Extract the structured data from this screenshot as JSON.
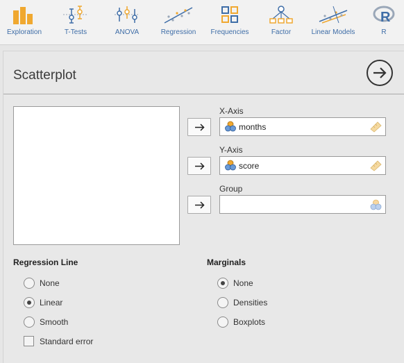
{
  "toolbar": {
    "items": [
      {
        "label": "Exploration",
        "icon": "bar-chart-icon"
      },
      {
        "label": "T-Tests",
        "icon": "ttest-icon"
      },
      {
        "label": "ANOVA",
        "icon": "anova-icon"
      },
      {
        "label": "Regression",
        "icon": "regression-icon"
      },
      {
        "label": "Frequencies",
        "icon": "frequencies-icon"
      },
      {
        "label": "Factor",
        "icon": "factor-icon"
      },
      {
        "label": "Linear Models",
        "icon": "linear-models-icon"
      },
      {
        "label": "R",
        "icon": "r-icon"
      }
    ]
  },
  "panel": {
    "title": "Scatterplot",
    "go_icon": "arrow-right-circle-icon"
  },
  "fields": {
    "x_axis": {
      "label": "X-Axis",
      "value": "months"
    },
    "y_axis": {
      "label": "Y-Axis",
      "value": "score"
    },
    "group": {
      "label": "Group",
      "value": ""
    }
  },
  "regression_line": {
    "heading": "Regression Line",
    "options": [
      "None",
      "Linear",
      "Smooth"
    ],
    "selected": "Linear",
    "standard_error": {
      "label": "Standard error",
      "checked": false
    }
  },
  "marginals": {
    "heading": "Marginals",
    "options": [
      "None",
      "Densities",
      "Boxplots"
    ],
    "selected": "None"
  },
  "colors": {
    "accent_orange": "#f0a830",
    "accent_blue": "#3e6da7",
    "ruler_yellow": "#f5d9a0"
  }
}
